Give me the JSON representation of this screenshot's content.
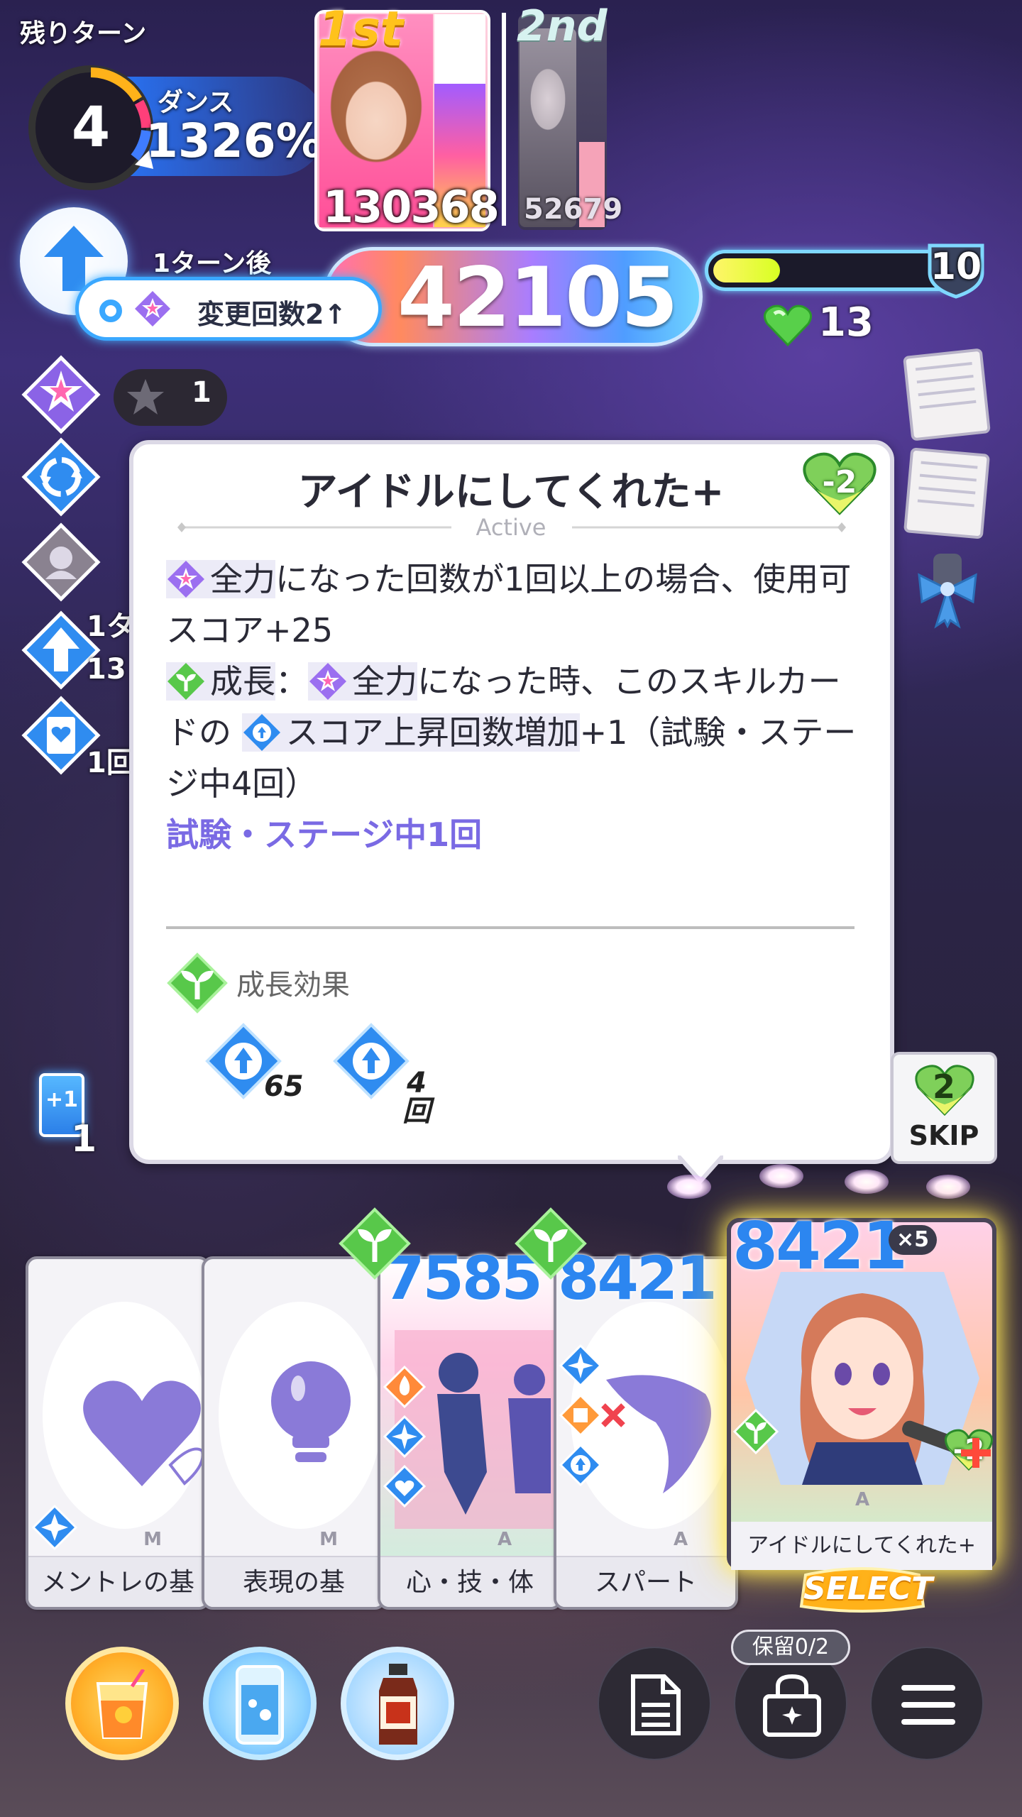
{
  "hud": {
    "turns_label": "残りターン",
    "turns_remaining": "4",
    "dance_label": "ダンス",
    "dance_percent": "1326%",
    "after_turn_label": "1ターン後",
    "change_count_label": "変更回数2↑",
    "score": "42105",
    "stamina_value": "10",
    "stamina_fill_fraction": 0.28,
    "hp": "13",
    "star_count": "1",
    "buff_cut_1": "1タ",
    "buff_cut_2": "13",
    "buff_cut_3": "1回"
  },
  "ranking": [
    {
      "rank": "1st",
      "score": "130368"
    },
    {
      "rank": "2nd",
      "score": "52679"
    }
  ],
  "tooltip": {
    "title": "アイドルにしてくれた+",
    "cost": "-2",
    "section": "Active",
    "line1_hl": "全力",
    "line1_rest": "になった回数が1回以上の場合、使用可",
    "line2": "スコア+25",
    "line3_hl1": "成長",
    "line3_sep": "：",
    "line3_hl2": "全力",
    "line3_rest": "になった時、このスキルカードの",
    "line3_hl3": "スコア上昇回数増加",
    "line3_tail": "+1（試験・ステージ中4回）",
    "limit": "試験・ステージ中1回",
    "growth_label": "成長効果",
    "growth_values": [
      "65",
      "4回"
    ]
  },
  "side": {
    "plus_card_label": "+1",
    "plus_card_count": "1",
    "skip_cost": "2",
    "skip_label": "SKIP"
  },
  "cards": [
    {
      "name": "メントレの基",
      "ml": "M"
    },
    {
      "name": "表現の基",
      "ml": "M"
    },
    {
      "name": "心・技・体",
      "ml": "A",
      "cost": "7585"
    },
    {
      "name": "スパート",
      "ml": "A",
      "cost": "8421"
    },
    {
      "name": "アイドルにしてくれた+",
      "ml": "A",
      "cost": "8421",
      "multiplier": "×5",
      "hp_cost": "-2"
    }
  ],
  "select_label": "SELECT",
  "bottom": {
    "hold_label": "保留0/2"
  },
  "colors": {
    "accent_blue": "#2c86f0",
    "score_gradient_start": "#ff6fb5",
    "score_gradient_end": "#6fd3ff",
    "stamina": "#d8ff22",
    "heart_green": "#58d04a",
    "select_glow": "#ffec5a"
  }
}
